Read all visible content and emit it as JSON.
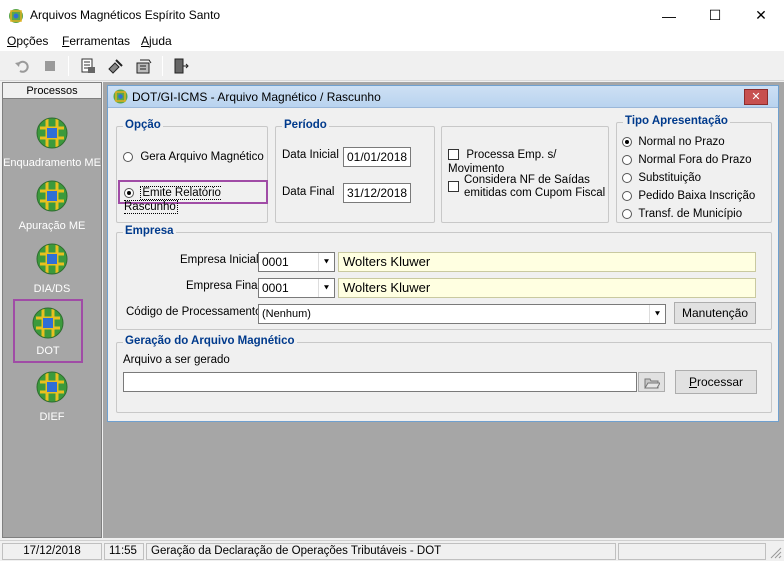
{
  "window": {
    "title": "Arquivos Magnéticos Espírito Santo",
    "minimize_glyph": "—",
    "maximize_glyph": "☐",
    "close_glyph": "✕"
  },
  "menu": {
    "items": [
      {
        "label": "Opções",
        "accel": "O",
        "rest": "pções"
      },
      {
        "label": "Ferramentas",
        "accel": "F",
        "rest": "erramentas"
      },
      {
        "label": "Ajuda",
        "accel": "A",
        "rest": "juda"
      }
    ]
  },
  "toolbar": {
    "icons": [
      "undo-icon",
      "stop-icon",
      "tool-1-icon",
      "tool-2-icon",
      "tool-3-icon",
      "exit-door-icon"
    ]
  },
  "sidebar": {
    "header": "Processos",
    "items": [
      {
        "label": "Enquadramento ME"
      },
      {
        "label": "Apuração ME"
      },
      {
        "label": "DIA/DS"
      },
      {
        "label": "DOT"
      },
      {
        "label": "DIEF"
      }
    ]
  },
  "child": {
    "title": "DOT/GI-ICMS - Arquivo Magnético / Rascunho",
    "close": "✕",
    "opcao": {
      "title": "Opção",
      "options": [
        {
          "label": "Gera Arquivo  Magnético",
          "selected": false
        },
        {
          "label": "Emite Relatório Rascunho",
          "selected": true
        }
      ]
    },
    "periodo": {
      "title": "Período",
      "data_inicial_label": "Data Inicial",
      "data_inicial_value": "01/01/2018",
      "data_final_label": "Data Final",
      "data_final_value": "31/12/2018"
    },
    "checks": {
      "processa": "Processa Emp. s/ Movimento",
      "considera_line1": "Considera NF de Saídas",
      "considera_line2": "emitidas com Cupom Fiscal"
    },
    "tipo": {
      "title": "Tipo Apresentação",
      "options": [
        {
          "label": "Normal no Prazo",
          "selected": true
        },
        {
          "label": "Normal Fora do  Prazo",
          "selected": false
        },
        {
          "label": "Substituição",
          "selected": false
        },
        {
          "label": "Pedido Baixa Inscrição",
          "selected": false
        },
        {
          "label": "Transf. de Município",
          "selected": false
        }
      ]
    },
    "empresa": {
      "title": "Empresa",
      "inicial_label": "Empresa Inicial",
      "inicial_code": "0001",
      "inicial_name": "Wolters Kluwer",
      "final_label": "Empresa Final",
      "final_code": "0001",
      "final_name": "Wolters Kluwer",
      "codigo_label": "Código de Processamento",
      "codigo_value": "(Nenhum)",
      "manutencao_button": "Manutenção"
    },
    "geracao": {
      "title": "Geração do Arquivo Magnético",
      "arquivo_label": "Arquivo a ser gerado",
      "arquivo_value": "",
      "processar_accel": "P",
      "processar_rest": "rocessar"
    }
  },
  "status": {
    "date": "17/12/2018",
    "time": "11:55",
    "message": "Geração da Declaração de Operações Tributáveis - DOT",
    "extra": ""
  },
  "colors": {
    "accent_title": "#003a8c",
    "highlight": "#a04ca6",
    "sidebar_bg": "#a6a6a6"
  }
}
